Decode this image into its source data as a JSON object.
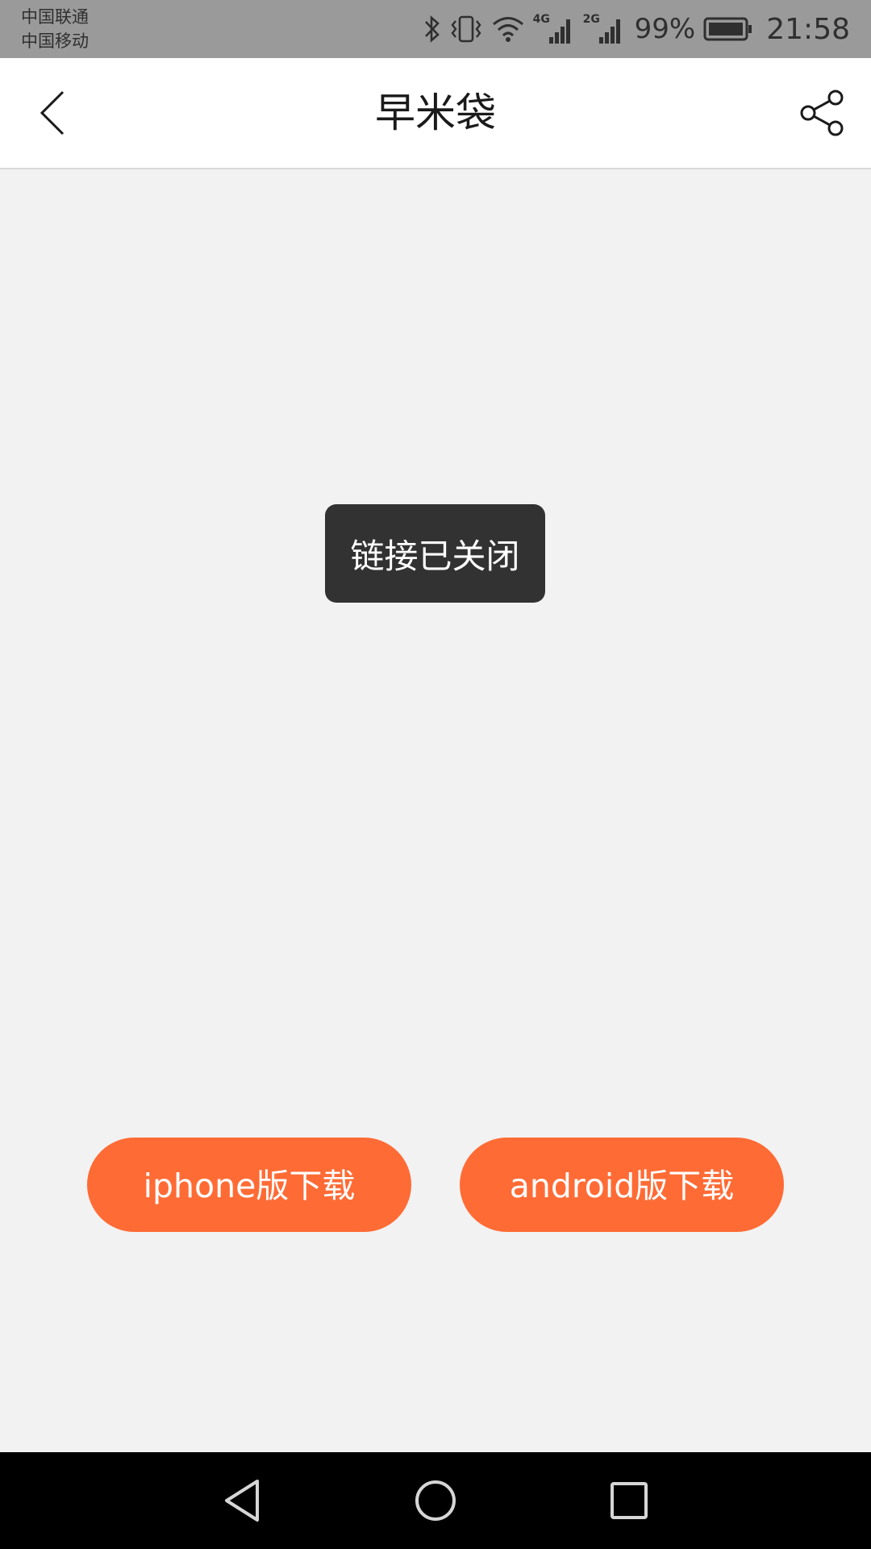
{
  "status_bar": {
    "carrier_1": "中国联通",
    "carrier_2": "中国移动",
    "net_1": "4G",
    "net_2": "2G",
    "battery": "99%",
    "time": "21:58",
    "icons": [
      "bluetooth-icon",
      "vibrate-icon",
      "wifi-icon",
      "signal-icon",
      "signal-icon",
      "battery-icon"
    ]
  },
  "header": {
    "title": "早米袋",
    "back_icon": "chevron-left-icon",
    "share_icon": "share-icon"
  },
  "toast": {
    "message": "链接已关闭"
  },
  "downloads": {
    "iphone_label": "iphone版下载",
    "android_label": "android版下载",
    "button_color": "#ff6b35"
  },
  "nav_bar": {
    "icons": [
      "nav-back-icon",
      "nav-home-icon",
      "nav-recent-icon"
    ]
  }
}
